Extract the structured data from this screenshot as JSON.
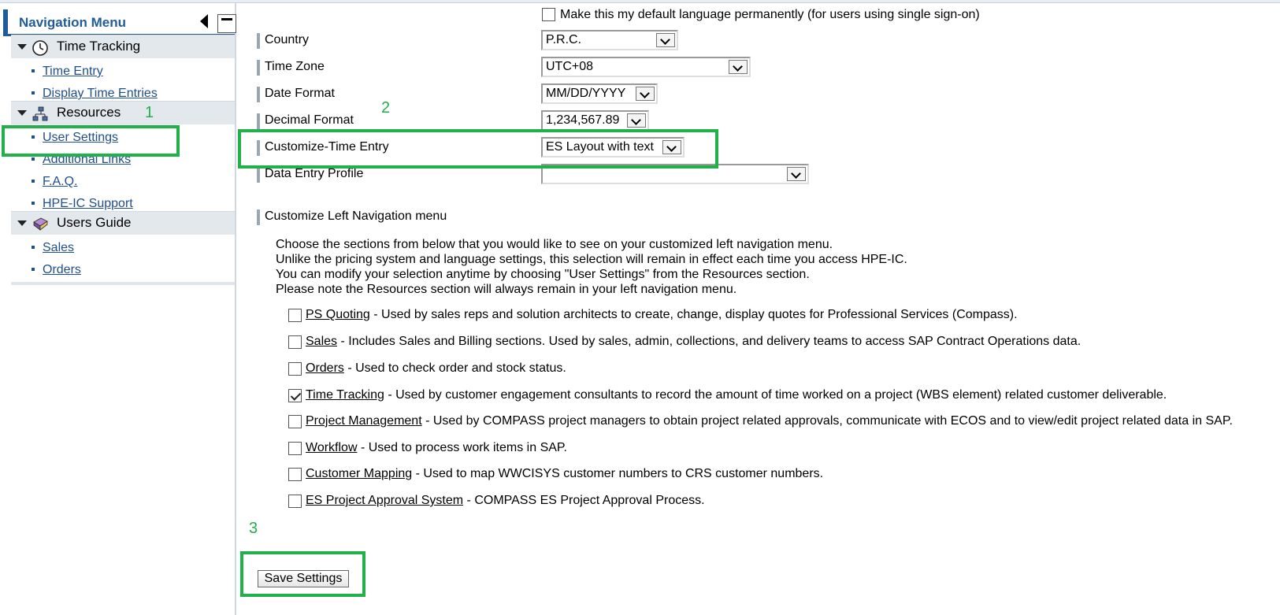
{
  "sidebar": {
    "title": "Navigation Menu",
    "sections": [
      {
        "label": "Time Tracking",
        "icon": "clock-icon",
        "items": [
          "Time Entry",
          "Display Time Entries"
        ]
      },
      {
        "label": "Resources",
        "icon": "network-icon",
        "items": [
          "User Settings",
          "Additional Links",
          "F.A.Q.",
          "HPE-IC Support"
        ]
      },
      {
        "label": "Users Guide",
        "icon": "book-icon",
        "items": [
          "Sales",
          "Orders"
        ]
      }
    ]
  },
  "callouts": {
    "one": "1",
    "two": "2",
    "three": "3"
  },
  "settings": {
    "default_language_label": "Make this my default language permanently (for users using single sign-on)",
    "fields": [
      {
        "label": "Country",
        "value": "P.R.C."
      },
      {
        "label": "Time Zone",
        "value": "UTC+08"
      },
      {
        "label": "Date Format",
        "value": "MM/DD/YYYY"
      },
      {
        "label": "Decimal Format",
        "value": "1,234,567.89"
      },
      {
        "label": "Customize-Time Entry",
        "value": "ES Layout with text"
      },
      {
        "label": "Data Entry Profile",
        "value": ""
      }
    ]
  },
  "left_nav": {
    "heading": "Customize Left Navigation menu",
    "paragraphs": [
      "Choose the sections from below that you would like to see on your customized left navigation menu.",
      "Unlike the pricing system and language settings, this selection will remain in effect each time you access HPE-IC.",
      "You can modify your selection anytime by choosing \"User Settings\" from the Resources section.",
      "Please note the Resources section will always remain in your left navigation menu."
    ],
    "options": [
      {
        "name": "PS Quoting",
        "desc": " - Used by sales reps and solution architects to create, change, display quotes for Professional Services (Compass).",
        "checked": false
      },
      {
        "name": "Sales",
        "desc": " - Includes Sales and Billing sections. Used by sales, admin, collections, and delivery teams to access SAP Contract Operations data.",
        "checked": false
      },
      {
        "name": "Orders",
        "desc": " - Used to check order and stock status.",
        "checked": false
      },
      {
        "name": "Time Tracking",
        "desc": " - Used by customer engagement consultants to record the amount of time worked on a project (WBS element) related customer deliverable.",
        "checked": true
      },
      {
        "name": "Project Management",
        "desc": " - Used by COMPASS project managers to obtain project related approvals, communicate with ECOS and to view/edit project related data in SAP.",
        "checked": false
      },
      {
        "name": "Workflow",
        "desc": " - Used to process work items in SAP.",
        "checked": false
      },
      {
        "name": "Customer Mapping",
        "desc": " - Used to map WWCISYS customer numbers to CRS customer numbers.",
        "checked": false
      },
      {
        "name": "ES Project Approval System",
        "desc": " - COMPASS ES Project Approval Process.",
        "checked": false
      }
    ]
  },
  "save_label": "Save Settings",
  "colors": {
    "accent": "#1f5c99",
    "callout": "#22b04a"
  }
}
